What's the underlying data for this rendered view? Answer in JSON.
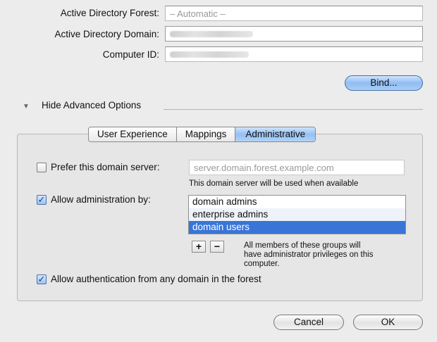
{
  "fields": {
    "forest_label": "Active Directory Forest:",
    "forest_value": "– Automatic –",
    "domain_label": "Active Directory Domain:",
    "computer_id_label": "Computer ID:"
  },
  "bind_button": "Bind...",
  "advanced": {
    "toggle_label": "Hide Advanced Options"
  },
  "tabs": [
    {
      "label": "User Experience",
      "selected": false
    },
    {
      "label": "Mappings",
      "selected": false
    },
    {
      "label": "Administrative",
      "selected": true
    }
  ],
  "admin": {
    "prefer_server_label": "Prefer this domain server:",
    "prefer_server_checked": false,
    "server_placeholder": "server.domain.forest.example.com",
    "server_note": "This domain server will be used when available",
    "allow_admin_label": "Allow administration by:",
    "allow_admin_checked": true,
    "groups": [
      "domain admins",
      "enterprise admins",
      "domain users"
    ],
    "selected_group": "domain users",
    "add_label": "+",
    "remove_label": "−",
    "groups_note_line1": "All members of these groups will",
    "groups_note_line2": "have administrator privileges on this",
    "groups_note_line3": "computer.",
    "allow_auth_label": "Allow authentication from any domain in the forest",
    "allow_auth_checked": true
  },
  "footer": {
    "cancel_label": "Cancel",
    "ok_label": "OK"
  },
  "colors": {
    "selection": "#3875d7",
    "default_button": "#8fbdf3"
  }
}
